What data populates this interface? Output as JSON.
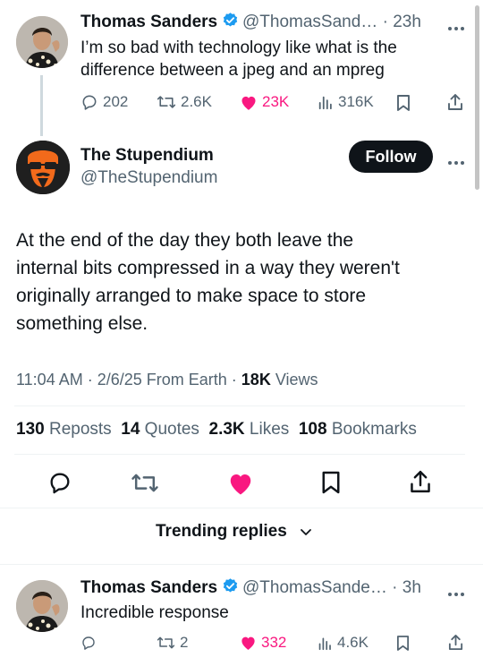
{
  "parent_tweet": {
    "name": "Thomas Sanders",
    "handle": "@ThomasSand…",
    "time": "23h",
    "text_line1": "I’m so bad with technology like what is the",
    "text_line2": "difference between a jpeg and an mpreg",
    "replies": "202",
    "reposts": "2.6K",
    "likes": "23K",
    "views": "316K"
  },
  "main_tweet": {
    "name": "The Stupendium",
    "handle": "@TheStupendium",
    "follow_label": "Follow",
    "text_lines": [
      "At the end of the day they both leave the",
      "internal bits compressed in a way they weren't",
      "originally arranged to make space to store",
      "something else."
    ],
    "time_date": "11:04 AM · 2/6/25 From Earth ·",
    "views_count": "18K",
    "views_label": "Views",
    "stats": {
      "reposts_count": "130",
      "reposts_label": "Reposts",
      "quotes_count": "14",
      "quotes_label": "Quotes",
      "likes_count": "2.3K",
      "likes_label": "Likes",
      "bookmarks_count": "108",
      "bookmarks_label": "Bookmarks"
    }
  },
  "trending": {
    "label": "Trending replies"
  },
  "reply_tweet": {
    "name": "Thomas Sanders",
    "handle": "@ThomasSande…",
    "time": "3h",
    "text": "Incredible response",
    "reposts": "2",
    "likes": "332",
    "views": "4.6K"
  },
  "colors": {
    "like_pink": "#f91880",
    "verified_blue": "#1d9bf0",
    "stupendium_orange": "#f26a1b"
  }
}
